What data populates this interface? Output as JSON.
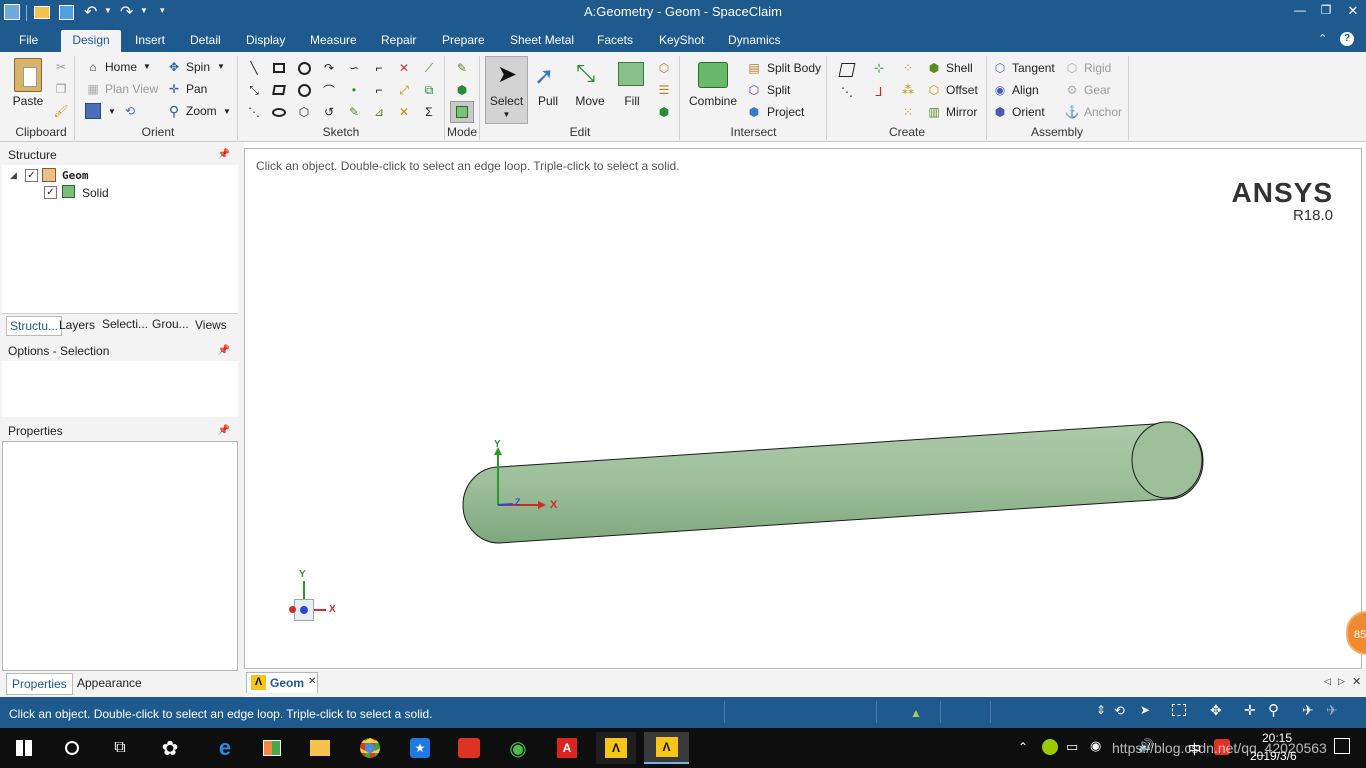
{
  "window": {
    "title": "A:Geometry - Geom - SpaceClaim",
    "controls": {
      "minimize": "—",
      "restore": "❐",
      "close": "✕"
    }
  },
  "ribbon_tabs": [
    {
      "label": "File"
    },
    {
      "label": "Design",
      "active": true
    },
    {
      "label": "Insert"
    },
    {
      "label": "Detail"
    },
    {
      "label": "Display"
    },
    {
      "label": "Measure"
    },
    {
      "label": "Repair"
    },
    {
      "label": "Prepare"
    },
    {
      "label": "Sheet Metal"
    },
    {
      "label": "Facets"
    },
    {
      "label": "KeyShot"
    },
    {
      "label": "Dynamics"
    }
  ],
  "ribbon": {
    "clipboard": {
      "group": "Clipboard",
      "paste": "Paste"
    },
    "orient": {
      "group": "Orient",
      "home": "Home",
      "plan_view": "Plan View",
      "spin": "Spin",
      "pan": "Pan",
      "zoom": "Zoom"
    },
    "sketch": {
      "group": "Sketch"
    },
    "mode": {
      "group": "Mode"
    },
    "edit": {
      "group": "Edit",
      "select": "Select",
      "pull": "Pull",
      "move": "Move",
      "fill": "Fill"
    },
    "intersect": {
      "group": "Intersect",
      "combine": "Combine",
      "split_body": "Split Body",
      "split": "Split",
      "project": "Project"
    },
    "create": {
      "group": "Create",
      "shell": "Shell",
      "offset": "Offset",
      "mirror": "Mirror"
    },
    "assembly": {
      "group": "Assembly",
      "tangent": "Tangent",
      "align": "Align",
      "orient": "Orient",
      "rigid": "Rigid",
      "gear": "Gear",
      "anchor": "Anchor"
    }
  },
  "structure": {
    "title": "Structure",
    "tree": [
      {
        "label": "Geom",
        "checked": true
      },
      {
        "label": "Solid",
        "checked": true
      }
    ],
    "tabs": [
      "Structu...",
      "Layers",
      "Selecti...",
      "Grou...",
      "Views"
    ]
  },
  "options": {
    "title": "Options - Selection"
  },
  "properties": {
    "title": "Properties",
    "tabs": [
      "Properties",
      "Appearance"
    ]
  },
  "viewport": {
    "hint": "Click an object. Double-click to select an edge loop. Triple-click to select a solid.",
    "brand": "ANSYS",
    "version": "R18.0",
    "axis_y": "Y",
    "axis_x": "X",
    "axis_z": "Z",
    "badge": "85",
    "solid_color": "#9dbf9a"
  },
  "doc_tab": {
    "label": "Geom",
    "close": "✕"
  },
  "status": {
    "text": "Click an object. Double-click to select an edge loop. Triple-click to select a solid."
  },
  "taskbar": {
    "time": "20:15",
    "date": "2019/3/6",
    "ime": "中",
    "watermark": "https://blog.csdn.net/qq_42020563"
  },
  "colors": {
    "accent": "#1e5a8e",
    "ribbon_bg": "#f3f3f3",
    "panel_border": "#b5b5b5"
  }
}
